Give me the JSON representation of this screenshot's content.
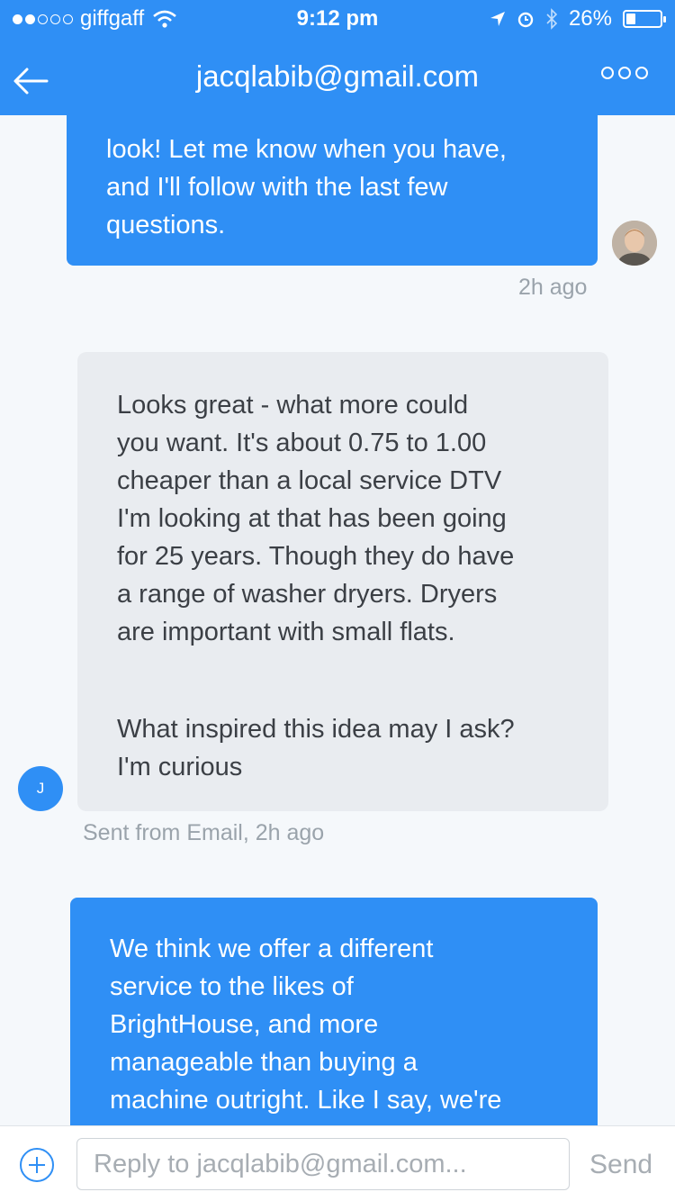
{
  "status_bar": {
    "carrier": "giffgaff",
    "time": "9:12 pm",
    "battery": "26%"
  },
  "header": {
    "title": "jacqlabib@gmail.com"
  },
  "messages": [
    {
      "direction": "outgoing",
      "lines": [
        "look! Let me know when you have,",
        "and I'll follow with the last few",
        "questions."
      ],
      "timestamp": "2h ago"
    },
    {
      "direction": "incoming",
      "avatar_initial": "J",
      "lines": [
        "Looks great - what more could",
        "you want. It's about 0.75 to 1.00",
        "cheaper than a local service DTV",
        "I'm looking at that has been going",
        "for 25 years. Though they do have",
        "a range of washer dryers. Dryers",
        "are important with small flats.",
        "",
        "What inspired this idea may I ask?",
        "I'm curious"
      ],
      "timestamp": "Sent from Email, 2h ago"
    },
    {
      "direction": "outgoing",
      "lines": [
        "We think we offer a different",
        "service to the likes of",
        "BrightHouse, and more",
        "manageable than buying a",
        "machine outright. Like I say, we're"
      ]
    }
  ],
  "composer": {
    "placeholder": "Reply to jacqlabib@gmail.com...",
    "send_label": "Send"
  }
}
